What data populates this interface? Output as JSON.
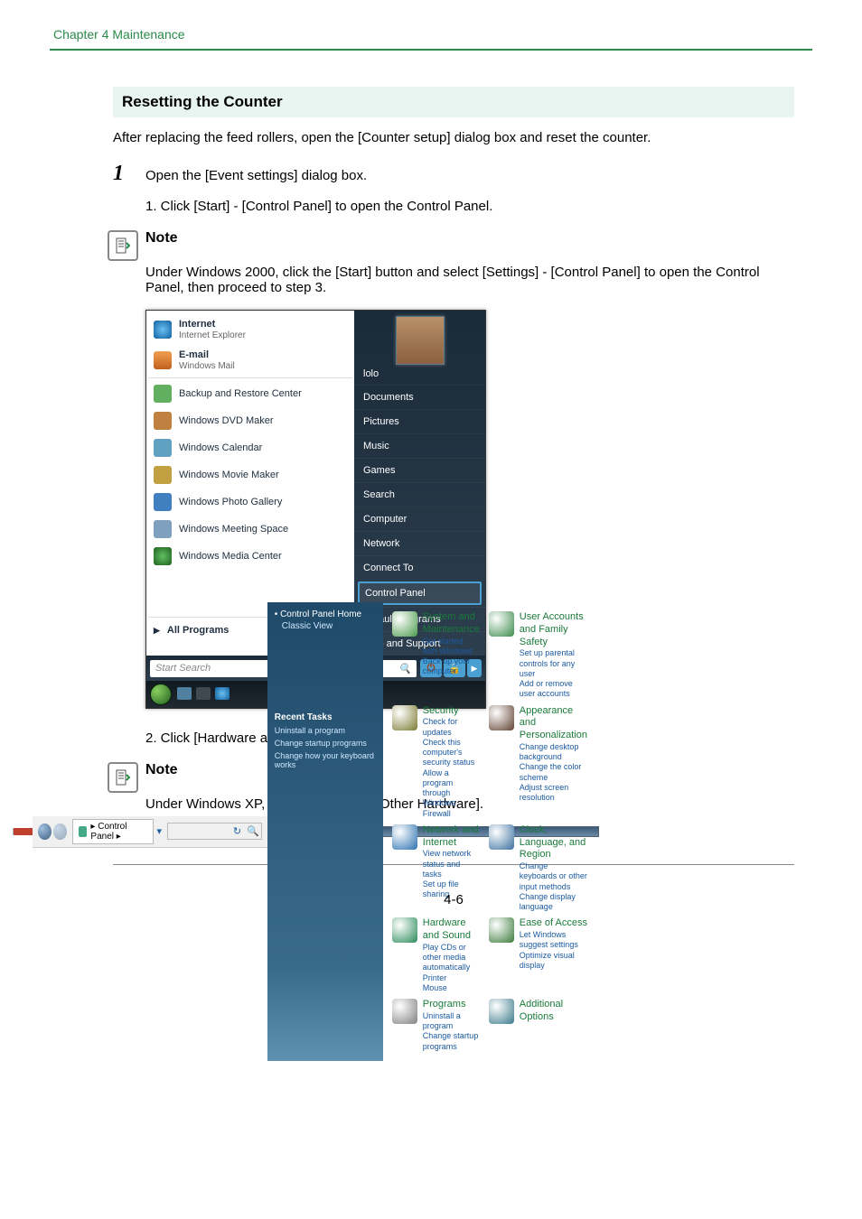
{
  "chapter_header": "Chapter 4   Maintenance",
  "section_title": "Resetting the Counter",
  "intro_text": "After replacing the feed rollers, open the [Counter setup] dialog box and reset the counter.",
  "step1": {
    "num": "1",
    "text": "Open the [Event settings] dialog box."
  },
  "substep1": "1.  Click [Start] - [Control Panel] to open the Control Panel.",
  "note1": {
    "label": "Note",
    "body": "Under Windows 2000, click the [Start] button and select [Settings] - [Control Panel] to open the Control Panel, then proceed to step 3."
  },
  "startmenu": {
    "left": {
      "internet": {
        "title": "Internet",
        "sub": "Internet Explorer"
      },
      "email": {
        "title": "E-mail",
        "sub": "Windows Mail"
      },
      "items": [
        "Backup and Restore Center",
        "Windows DVD Maker",
        "Windows Calendar",
        "Windows Movie Maker",
        "Windows Photo Gallery",
        "Windows Meeting Space",
        "Windows Media Center"
      ],
      "all_programs": "All Programs",
      "search_placeholder": "Start Search"
    },
    "right": {
      "user": "lolo",
      "items": [
        "Documents",
        "Pictures",
        "Music",
        "Games",
        "Search",
        "Computer",
        "Network",
        "Connect To"
      ],
      "control_panel": "Control Panel",
      "tail": [
        "Default Programs",
        "Help and Support"
      ]
    }
  },
  "substep2": "2.  Click [Hardware and Sound].",
  "note2": {
    "label": "Note",
    "body": "Under Windows XP, click [Printers and Other Hardware]."
  },
  "control_panel": {
    "breadcrumb": "▸ Control Panel ▸",
    "search_refresh": "↻",
    "side": {
      "home": "Control Panel Home",
      "classic": "Classic View",
      "recent_hdr": "Recent Tasks",
      "recent": [
        "Uninstall a program",
        "Change startup programs",
        "Change how your keyboard works"
      ]
    },
    "cats_left": [
      {
        "title": "System and Maintenance",
        "links": [
          "Get started with Windows",
          "Back up your computer"
        ],
        "color": "#4a9a4a"
      },
      {
        "title": "Security",
        "links": [
          "Check for updates",
          "Check this computer's security status",
          "Allow a program through Windows Firewall"
        ],
        "color": "#7a7a30"
      },
      {
        "title": "Network and Internet",
        "links": [
          "View network status and tasks",
          "Set up file sharing"
        ],
        "color": "#2a70b0"
      },
      {
        "title": "Hardware and Sound",
        "links": [
          "Play CDs or other media automatically",
          "Printer",
          "Mouse"
        ],
        "color": "#2a8a5a"
      },
      {
        "title": "Programs",
        "links": [
          "Uninstall a program",
          "Change startup programs"
        ],
        "color": "#808080"
      }
    ],
    "cats_right": [
      {
        "title": "User Accounts and Family Safety",
        "links": [
          "Set up parental controls for any user",
          "Add or remove user accounts"
        ],
        "color": "#3a8a4a"
      },
      {
        "title": "Appearance and Personalization",
        "links": [
          "Change desktop background",
          "Change the color scheme",
          "Adjust screen resolution"
        ],
        "color": "#604030"
      },
      {
        "title": "Clock, Language, and Region",
        "links": [
          "Change keyboards or other input methods",
          "Change display language"
        ],
        "color": "#3a70a0"
      },
      {
        "title": "Ease of Access",
        "links": [
          "Let Windows suggest settings",
          "Optimize visual display"
        ],
        "color": "#3a7a3a"
      },
      {
        "title": "Additional Options",
        "links": [],
        "color": "#3a7a8a"
      }
    ]
  },
  "page_number": "4-6"
}
